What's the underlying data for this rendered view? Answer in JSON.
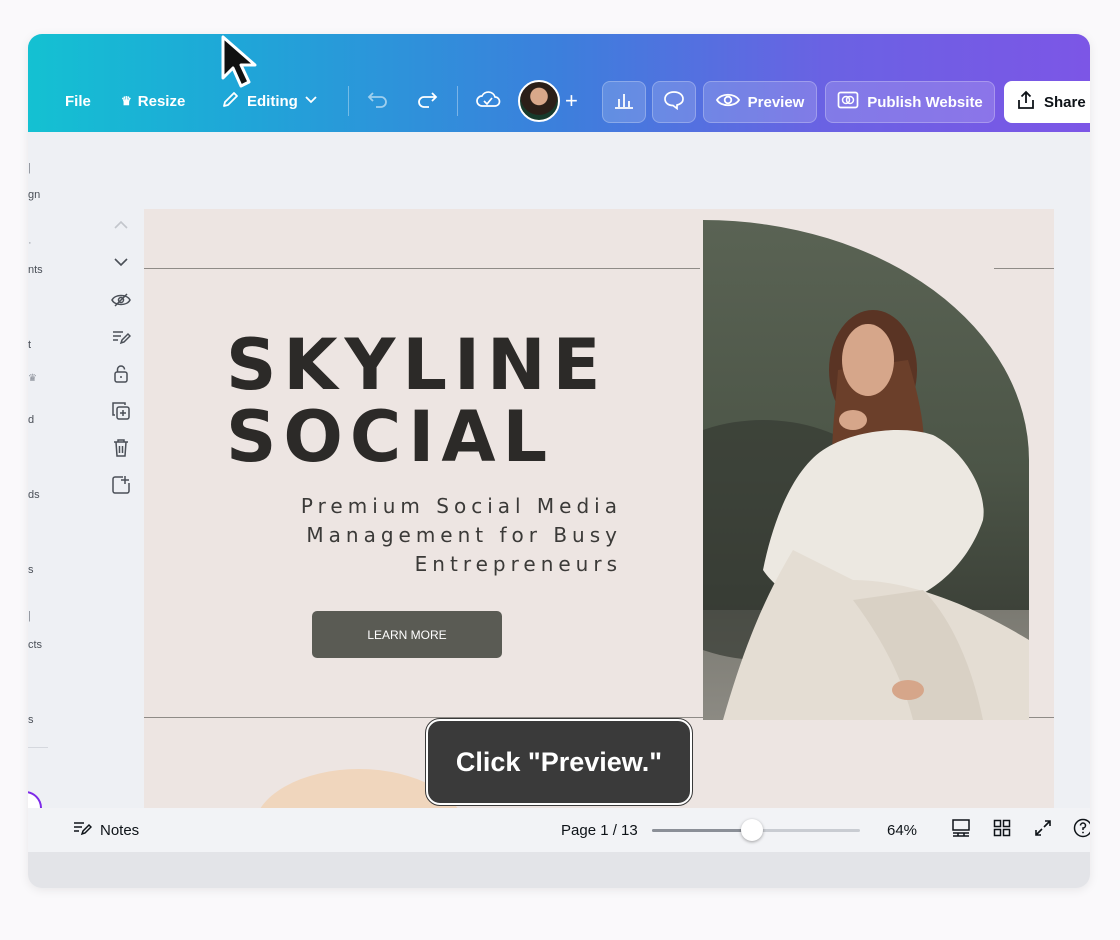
{
  "toolbar": {
    "file_label": "File",
    "resize_label": "Resize",
    "editing_label": "Editing",
    "preview_label": "Preview",
    "publish_label": "Publish Website",
    "share_label": "Share"
  },
  "sidebar": {
    "items": [
      {
        "label": "gn"
      },
      {
        "label": "nts"
      },
      {
        "label": "t"
      },
      {
        "label": "d"
      },
      {
        "label": "ds"
      },
      {
        "label": "s"
      },
      {
        "label": "cts"
      },
      {
        "label": "s"
      }
    ]
  },
  "slide": {
    "headline_line1": "SKYLINE",
    "headline_line2": "SOCIAL",
    "subline_line1": "Premium Social Media",
    "subline_line2": "Management for Busy",
    "subline_line3": "Entrepreneurs",
    "button_label": "LEARN MORE"
  },
  "tooltip": {
    "text": "Click \"Preview.\""
  },
  "bottombar": {
    "notes_label": "Notes",
    "page_indicator": "Page 1 / 13",
    "zoom_label": "64%",
    "zoom_value": 64
  },
  "colors": {
    "toolbar_start": "#14c1d2",
    "toolbar_end": "#7c56e6",
    "slide_bg": "#ede5e2",
    "button_bg": "#5a5b54",
    "headline": "#2c2a28"
  }
}
